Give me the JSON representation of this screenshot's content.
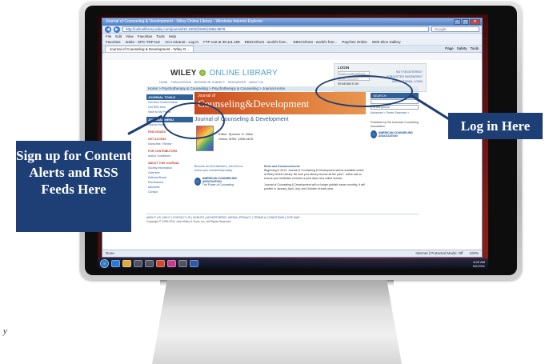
{
  "browser": {
    "title": "Journal of Counseling & Development - Wiley Online Library - Windows Internet Explorer",
    "url": "http://onlinelibrary.wiley.com/journal/10.1002/(ISSN)1556-6676",
    "search_placeholder": "Google",
    "menu": [
      "File",
      "Edit",
      "View",
      "Favorites",
      "Tools",
      "Help"
    ],
    "favorites": [
      "Favorites",
      "InSite - SPC-TDP-ILE",
      "ACA Intranet - Log In",
      "FTP root at 38.111.169",
      "EBSCOhost - world's fore...",
      "EBSCOhost - world's fore...",
      "Paychex Online",
      "Web Slice Gallery"
    ],
    "commands": [
      "Page",
      "Safety",
      "Tools"
    ],
    "tab": "Journal of Counseling & Development - Wiley O...",
    "status_left": "Done",
    "status_zone": "Internet | Protected Mode: Off",
    "zoom": "100%"
  },
  "page": {
    "logo_wiley": "WILEY",
    "logo_online": "ONLINE LIBRARY",
    "top_nav": [
      "Home",
      "Publications",
      "Browse by Subject",
      "Resources",
      "About Us"
    ],
    "breadcrumb": "Home > Psychotherapy & Counseling > Psychotherapy & Counseling > Journal Home",
    "login": {
      "title": "LOGIN",
      "email_placeholder": "Enter e-mail address",
      "password_placeholder": "Enter password",
      "remember": "REMEMBER ME",
      "links": [
        "NOT REGISTERED?",
        "FORGOTTEN PASSWORD?",
        "INSTITUTIONAL LOGIN"
      ]
    },
    "journal_tools": {
      "heading": "JOURNAL TOOLS",
      "items": [
        "Get New Content Alerts",
        "Get RSS feed",
        "Save to My Profile"
      ]
    },
    "journal_menu": {
      "heading": "JOURNAL MENU",
      "items": [
        "Journal Home"
      ],
      "sections": [
        {
          "title": "FIND ISSUES",
          "items": []
        },
        {
          "title": "GET ACCESS",
          "items": [
            "Subscribe / Renew"
          ]
        },
        {
          "title": "FOR CONTRIBUTORS",
          "items": [
            "Author Guidelines"
          ]
        },
        {
          "title": "ABOUT THIS JOURNAL",
          "items": [
            "Society Information",
            "Overview",
            "Editorial Board",
            "Permissions",
            "Advertise",
            "Contact"
          ]
        }
      ]
    },
    "banner_small": "Journal of",
    "banner_big": "Counseling&Development",
    "journal_title": "Journal of Counseling & Development",
    "editor": "Editor: Spencer G. Niles",
    "issn": "Online ISSN: 1556-6676",
    "members_text": "Become an ACA Member | Join ACA or renew your membership today.",
    "aca_name": "AMERICAN COUNSELING ASSOCIATION",
    "aca_tagline": "The Power of Counseling",
    "news_heading": "News and Announcements",
    "news_1": "Beginning in 2012, Journal of Counseling & Development will be available online at Wiley Online Library. Be sure your library renews all the print + online rate to ensure your institution receives a print issue and online access.",
    "news_2": "Journal of Counseling & Development will no longer publish issues monthly. It will publish in January, April, July, and October of each year.",
    "search": {
      "label": "SEARCH",
      "scope": "In this journal",
      "links": "Advanced > Saved Searches >"
    },
    "published_by": "Published by the American Counseling Association",
    "footer_links": "ABOUT US | HELP | CONTACT US | AGENTS | ADVERTISERS | MEDIA | PRIVACY | TERMS & CONDITIONS | SITE MAP",
    "copyright": "Copyright © 1999-2011 John Wiley & Sons, Inc. All Rights Reserved"
  },
  "taskbar": {
    "time": "8:20 AM",
    "date": "9/2/2011"
  },
  "callouts": {
    "left": "Sign up for Content Alerts and RSS Feeds Here",
    "right": "Log in Here"
  },
  "stray_text": "y",
  "colors": {
    "callout": "#1e3f75",
    "wiley_blue": "#2f6098",
    "banner_orange": "#d65a25"
  }
}
